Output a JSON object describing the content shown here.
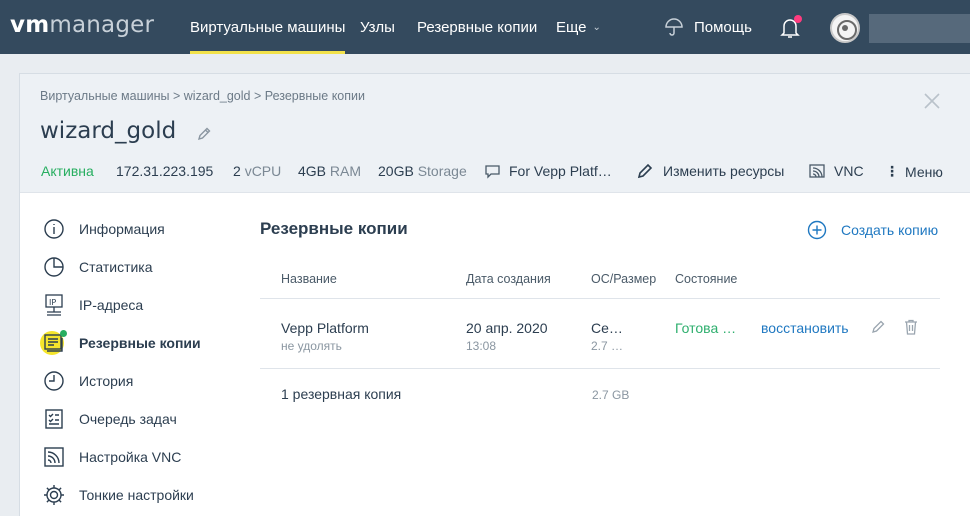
{
  "header": {
    "logo_vm": "vm",
    "logo_manager": "manager",
    "nav": [
      "Виртуальные машины",
      "Узлы",
      "Резервные копии",
      "Еще"
    ],
    "help": "Помощь"
  },
  "breadcrumb": [
    "Виртуальные машины",
    ">",
    "wizard_gold",
    ">",
    "Резервные копии"
  ],
  "vm": {
    "name": "wizard_gold",
    "status": "Активна",
    "ip": "172.31.223.195",
    "cpu_num": "2",
    "cpu_unit": "vCPU",
    "ram_num": "4GB",
    "ram_unit": "RAM",
    "storage_num": "20GB",
    "storage_unit": "Storage",
    "comment": "For Vepp Platf…"
  },
  "actions": {
    "edit_resources": "Изменить ресурсы",
    "vnc": "VNC",
    "menu": "Меню"
  },
  "sidebar": [
    {
      "label": "Информация",
      "icon": "info-icon"
    },
    {
      "label": "Статистика",
      "icon": "pie-chart-icon"
    },
    {
      "label": "IP-адреса",
      "icon": "ip-icon"
    },
    {
      "label": "Резервные копии",
      "icon": "backup-icon"
    },
    {
      "label": "История",
      "icon": "clock-icon"
    },
    {
      "label": "Очередь задач",
      "icon": "task-list-icon"
    },
    {
      "label": "Настройка VNC",
      "icon": "vnc-icon"
    },
    {
      "label": "Тонкие настройки",
      "icon": "gear-icon"
    }
  ],
  "main": {
    "title": "Резервные копии",
    "create_label": "Создать копию",
    "columns": [
      "Название",
      "Дата создания",
      "ОС/Размер",
      "Состояние"
    ],
    "row": {
      "name": "Vepp Platform",
      "note": "не удолять",
      "date": "20 апр. 2020",
      "time": "13:08",
      "os": "Се…",
      "size": "2.7 …",
      "state": "Готова …",
      "restore": "восстановить"
    },
    "footer": {
      "count": "1 резервная копия",
      "total": "2.7 GB"
    }
  },
  "colors": {
    "topbar": "#344a5e",
    "accent_yellow": "#f2e24b",
    "link_blue": "#1f78c1",
    "status_green": "#27ae60"
  }
}
